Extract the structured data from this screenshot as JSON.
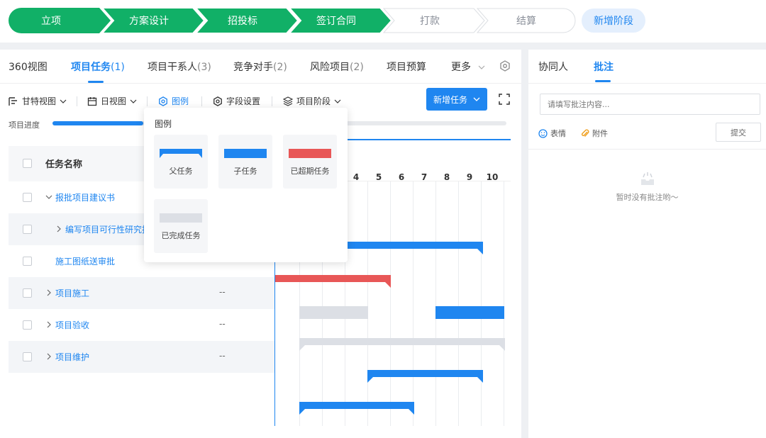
{
  "stages": [
    {
      "label": "立项",
      "status": "done"
    },
    {
      "label": "方案设计",
      "status": "done"
    },
    {
      "label": "招投标",
      "status": "done"
    },
    {
      "label": "签订合同",
      "status": "done"
    },
    {
      "label": "打款",
      "status": "todo"
    },
    {
      "label": "结算",
      "status": "todo"
    }
  ],
  "add_stage_label": "新增阶段",
  "tabs": [
    {
      "label": "360视图",
      "count": ""
    },
    {
      "label": "项目任务",
      "count": "(1)"
    },
    {
      "label": "项目干系人",
      "count": "(3)"
    },
    {
      "label": "竞争对手",
      "count": "(2)"
    },
    {
      "label": "风险项目",
      "count": "(2)"
    },
    {
      "label": "项目预算",
      "count": ""
    },
    {
      "label": "更多",
      "count": ""
    }
  ],
  "toolbar": {
    "gantt_view": "甘特视图",
    "day_view": "日视图",
    "legend": "图例",
    "field_settings": "字段设置",
    "project_stage": "项目阶段",
    "new_task": "新增任务"
  },
  "progress": {
    "label": "项目进度",
    "value": 0.2
  },
  "table": {
    "header": "任务名称",
    "rows": [
      {
        "name": "报批项目建议书",
        "expand": "open",
        "indent": 0,
        "col2": ""
      },
      {
        "name": "编写项目可行性研究报",
        "expand": "closed",
        "indent": 1,
        "col2": ""
      },
      {
        "name": "施工图纸送审批",
        "expand": "none",
        "indent": 0,
        "col2": "--"
      },
      {
        "name": "项目施工",
        "expand": "closed",
        "indent": 0,
        "col2": "--"
      },
      {
        "name": "项目验收",
        "expand": "closed",
        "indent": 0,
        "col2": "--"
      },
      {
        "name": "项目维护",
        "expand": "closed",
        "indent": 0,
        "col2": "--"
      }
    ]
  },
  "gantt": {
    "days": [
      "4",
      "5",
      "6",
      "7",
      "8",
      "9",
      "10"
    ],
    "colors": {
      "parent": "#1f86f0",
      "child": "#1f86f0",
      "overdue": "#e85757",
      "done": "#dcdfe5"
    }
  },
  "legend": {
    "title": "图例",
    "items": [
      {
        "label": "父任务",
        "kind": "parent",
        "color": "#1f86f0"
      },
      {
        "label": "子任务",
        "kind": "child",
        "color": "#1f86f0"
      },
      {
        "label": "已超期任务",
        "kind": "overdue",
        "color": "#e85757"
      },
      {
        "label": "已完成任务",
        "kind": "done",
        "color": "#dcdfe5"
      }
    ]
  },
  "right": {
    "tabs": [
      "协同人",
      "批注"
    ],
    "placeholder": "请填写批注内容...",
    "emoji_label": "表情",
    "attach_label": "附件",
    "submit_label": "提交",
    "empty_text": "暂时没有批注哟～"
  }
}
